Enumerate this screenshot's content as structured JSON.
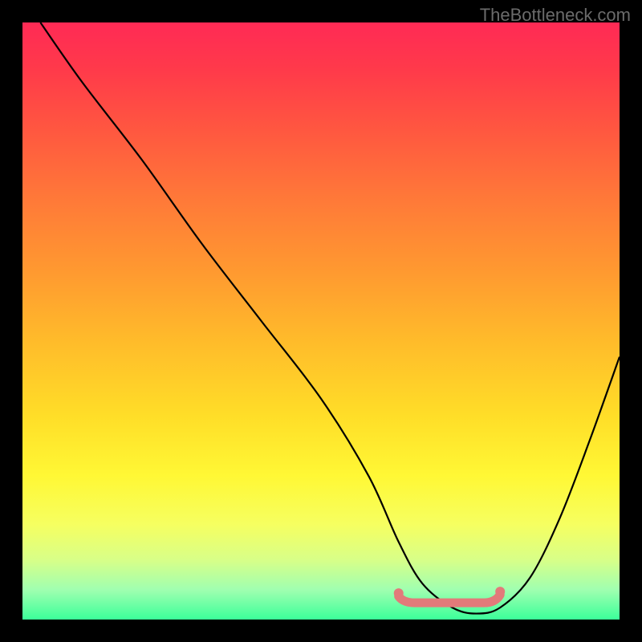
{
  "watermark": "TheBottleneck.com",
  "chart_data": {
    "type": "line",
    "title": "",
    "xlabel": "",
    "ylabel": "",
    "xlim": [
      0,
      100
    ],
    "ylim": [
      0,
      100
    ],
    "grid": false,
    "legend": false,
    "series": [
      {
        "name": "bottleneck-curve",
        "x": [
          3,
          10,
          20,
          30,
          40,
          50,
          58,
          63,
          67,
          72,
          76,
          80,
          85,
          90,
          95,
          100
        ],
        "y": [
          100,
          90,
          77,
          63,
          50,
          37,
          24,
          13,
          6,
          2,
          1,
          2,
          7,
          17,
          30,
          44
        ]
      }
    ],
    "annotations": [
      {
        "name": "optimal-range",
        "x_start": 63,
        "x_end": 80,
        "y": 2
      }
    ],
    "background_gradient": {
      "direction": "vertical",
      "stops": [
        {
          "pos": 0.0,
          "color": "#ff2a55"
        },
        {
          "pos": 0.5,
          "color": "#ffbd2a"
        },
        {
          "pos": 0.8,
          "color": "#fff835"
        },
        {
          "pos": 1.0,
          "color": "#3bff9a"
        }
      ]
    }
  }
}
